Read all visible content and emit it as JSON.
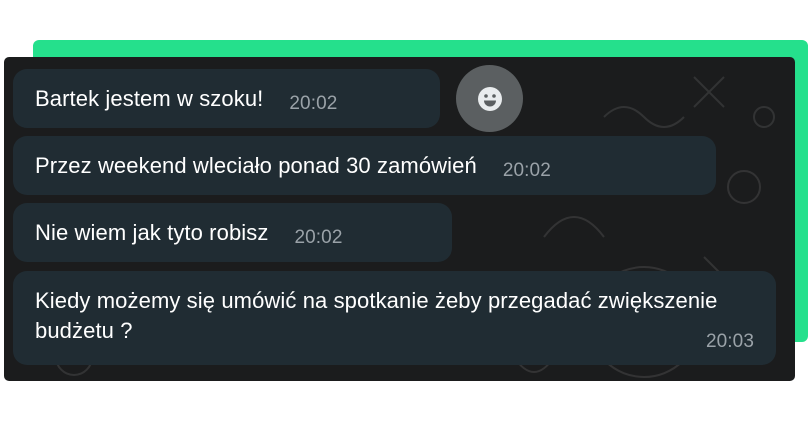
{
  "colors": {
    "accent": "#25e08c",
    "panel_background": "#1b1c1d",
    "bubble_background": "#202c33",
    "emoji_button_background": "#5b5f61"
  },
  "messages": [
    {
      "text": "Bartek jestem w szoku!",
      "time": "20:02"
    },
    {
      "text": "Przez weekend wleciało ponad 30 zamówień",
      "time": "20:02"
    },
    {
      "text": "Nie wiem jak tyto robisz",
      "time": "20:02"
    },
    {
      "text": "Kiedy możemy się umówić na spotkanie żeby przegadać zwiększenie budżetu ?",
      "time": "20:03"
    }
  ],
  "icons": {
    "reaction": "smiley-icon"
  }
}
